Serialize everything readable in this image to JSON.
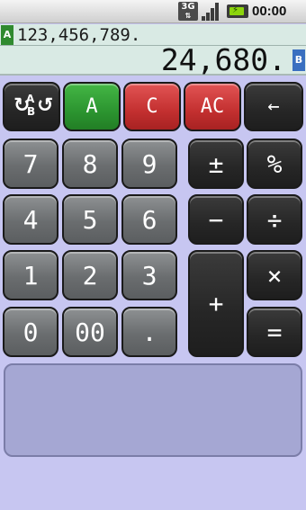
{
  "status_bar": {
    "network_label": "3G",
    "network_icon": "3g-data-icon",
    "signal_icon": "signal-strength-icon",
    "battery_icon": "battery-charging-icon",
    "time": "00:00"
  },
  "display": {
    "register_a": {
      "tag": "A",
      "value": "123,456,789."
    },
    "register_b": {
      "tag": "B",
      "value": "24,680."
    }
  },
  "keys": {
    "swap": {
      "label": "A/B",
      "icon": "swap-ab-icon"
    },
    "a": "A",
    "c": "C",
    "ac": "AC",
    "backspace": "←",
    "seven": "7",
    "eight": "8",
    "nine": "9",
    "four": "4",
    "five": "5",
    "six": "6",
    "one": "1",
    "two": "2",
    "three": "3",
    "zero": "0",
    "double_zero": "00",
    "decimal": ".",
    "plus_minus": "±",
    "percent": "%",
    "minus": "−",
    "divide": "÷",
    "plus": "+",
    "multiply": "×",
    "equals": "="
  },
  "colors": {
    "background": "#c7c6f1",
    "display_bg": "#d9eae4",
    "register_a_tag": "#2f8a2f",
    "register_b_tag": "#3a6fc0",
    "key_a": "#2c9530",
    "key_c": "#c33030",
    "key_operator": "#262626",
    "key_number": "#6a6d6f"
  }
}
